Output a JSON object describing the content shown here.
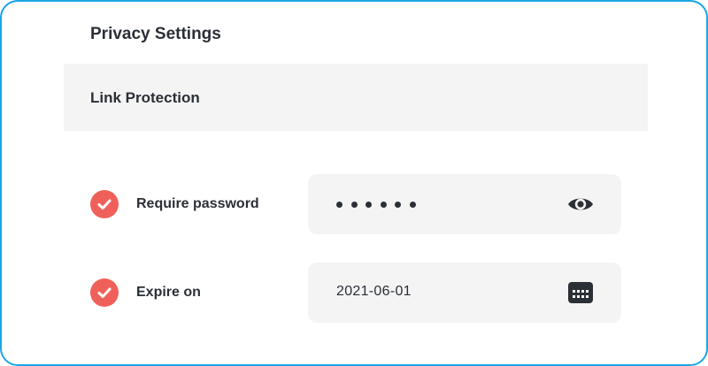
{
  "page": {
    "title": "Privacy Settings"
  },
  "section": {
    "title": "Link Protection"
  },
  "rows": [
    {
      "label": "Require password",
      "checked": true,
      "value_masked_length": 6,
      "action_icon": "eye-icon"
    },
    {
      "label": "Expire on",
      "checked": true,
      "value": "2021-06-01",
      "action_icon": "calendar-icon"
    }
  ],
  "colors": {
    "frame_border": "#1aa6e4",
    "check_badge": "#f0605a",
    "panel_background": "#f4f4f4",
    "text": "#2b2f36"
  }
}
